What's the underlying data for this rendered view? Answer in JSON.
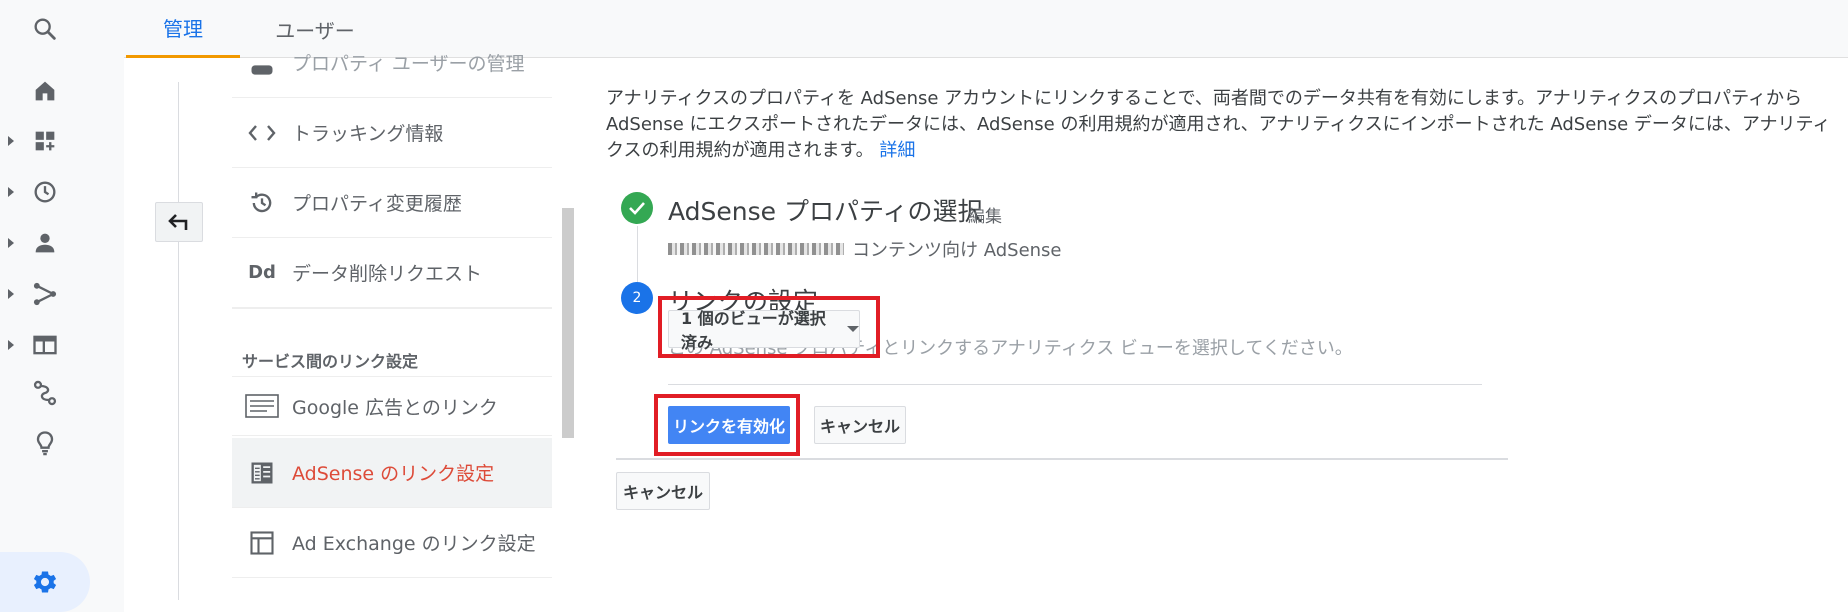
{
  "tabs": [
    {
      "label": "管理"
    },
    {
      "label": "ユーザー"
    }
  ],
  "menu": {
    "items": [
      {
        "label": "プロパティ ユーザーの管理",
        "icon": "people-icon"
      },
      {
        "label": "トラッキング情報",
        "icon": "code-icon"
      },
      {
        "label": "プロパティ変更履歴",
        "icon": "history-icon"
      },
      {
        "label": "データ削除リクエスト",
        "icon": "data-delete-icon",
        "icon_text": "Dd"
      }
    ],
    "section_heading": "サービス間のリンク設定",
    "link_items": [
      {
        "label": "Google 広告とのリンク",
        "icon": "ads-link-icon"
      },
      {
        "label": "AdSense のリンク設定",
        "icon": "adsense-icon",
        "active": true
      },
      {
        "label": "Ad Exchange のリンク設定",
        "icon": "ad-exchange-icon"
      }
    ]
  },
  "content": {
    "description": "アナリティクスのプロパティを AdSense アカウントにリンクすることで、両者間でのデータ共有を有効にします。アナリティクスのプロパティから AdSense にエクスポートされたデータには、AdSense の利用規約が適用され、アナリティクスにインポートされた AdSense データには、アナリティクスの利用規約が適用されます。",
    "details_link": "詳細",
    "step1": {
      "title": "AdSense プロパティの選択",
      "edit": "編集",
      "subtitle": "コンテンツ向け AdSense"
    },
    "step2": {
      "number": "2",
      "title": "リンクの設定",
      "hint": "この AdSense プロパティとリンクするアナリティクス ビューを選択してください。",
      "view_dropdown": "1 個のビューが選択済み"
    },
    "enable_button": "リンクを有効化",
    "cancel_button": "キャンセル",
    "outer_cancel_button": "キャンセル"
  },
  "colors": {
    "accent": "#1a73e8",
    "active_menu_text": "#dd4b39",
    "highlight_box": "#e11d25",
    "primary_button": "#4285f4",
    "step_complete": "#34a853"
  }
}
